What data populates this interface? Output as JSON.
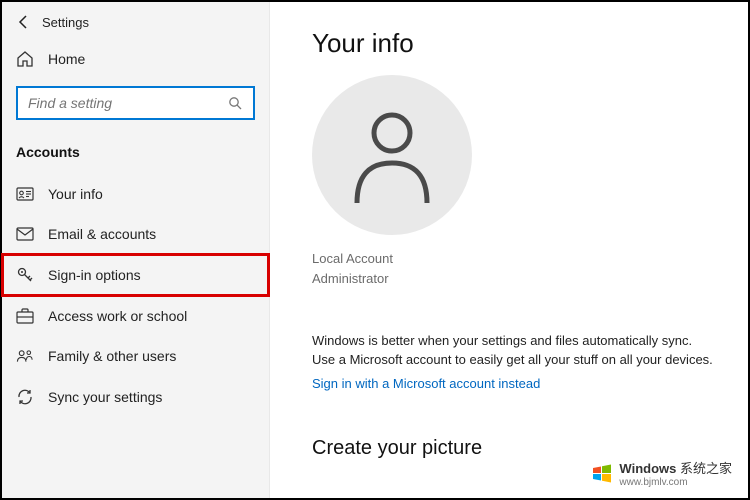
{
  "topbar": {
    "title": "Settings"
  },
  "home": {
    "label": "Home"
  },
  "search": {
    "placeholder": "Find a setting"
  },
  "category": "Accounts",
  "nav": [
    {
      "label": "Your info",
      "icon": "id-icon"
    },
    {
      "label": "Email & accounts",
      "icon": "mail-icon"
    },
    {
      "label": "Sign-in options",
      "icon": "key-icon",
      "highlighted": true
    },
    {
      "label": "Access work or school",
      "icon": "briefcase-icon"
    },
    {
      "label": "Family & other users",
      "icon": "users-icon"
    },
    {
      "label": "Sync your settings",
      "icon": "sync-icon"
    }
  ],
  "main": {
    "title": "Your info",
    "account_type_line1": "Local Account",
    "account_type_line2": "Administrator",
    "sync_text": "Windows is better when your settings and files automatically sync. Use a Microsoft account to easily get all your stuff on all your devices.",
    "sync_link": "Sign in with a Microsoft account instead",
    "picture_section": "Create your picture"
  },
  "watermark": {
    "brand": "Windows",
    "site": "www.bjmlv.com",
    "suffix": "系统之家"
  }
}
